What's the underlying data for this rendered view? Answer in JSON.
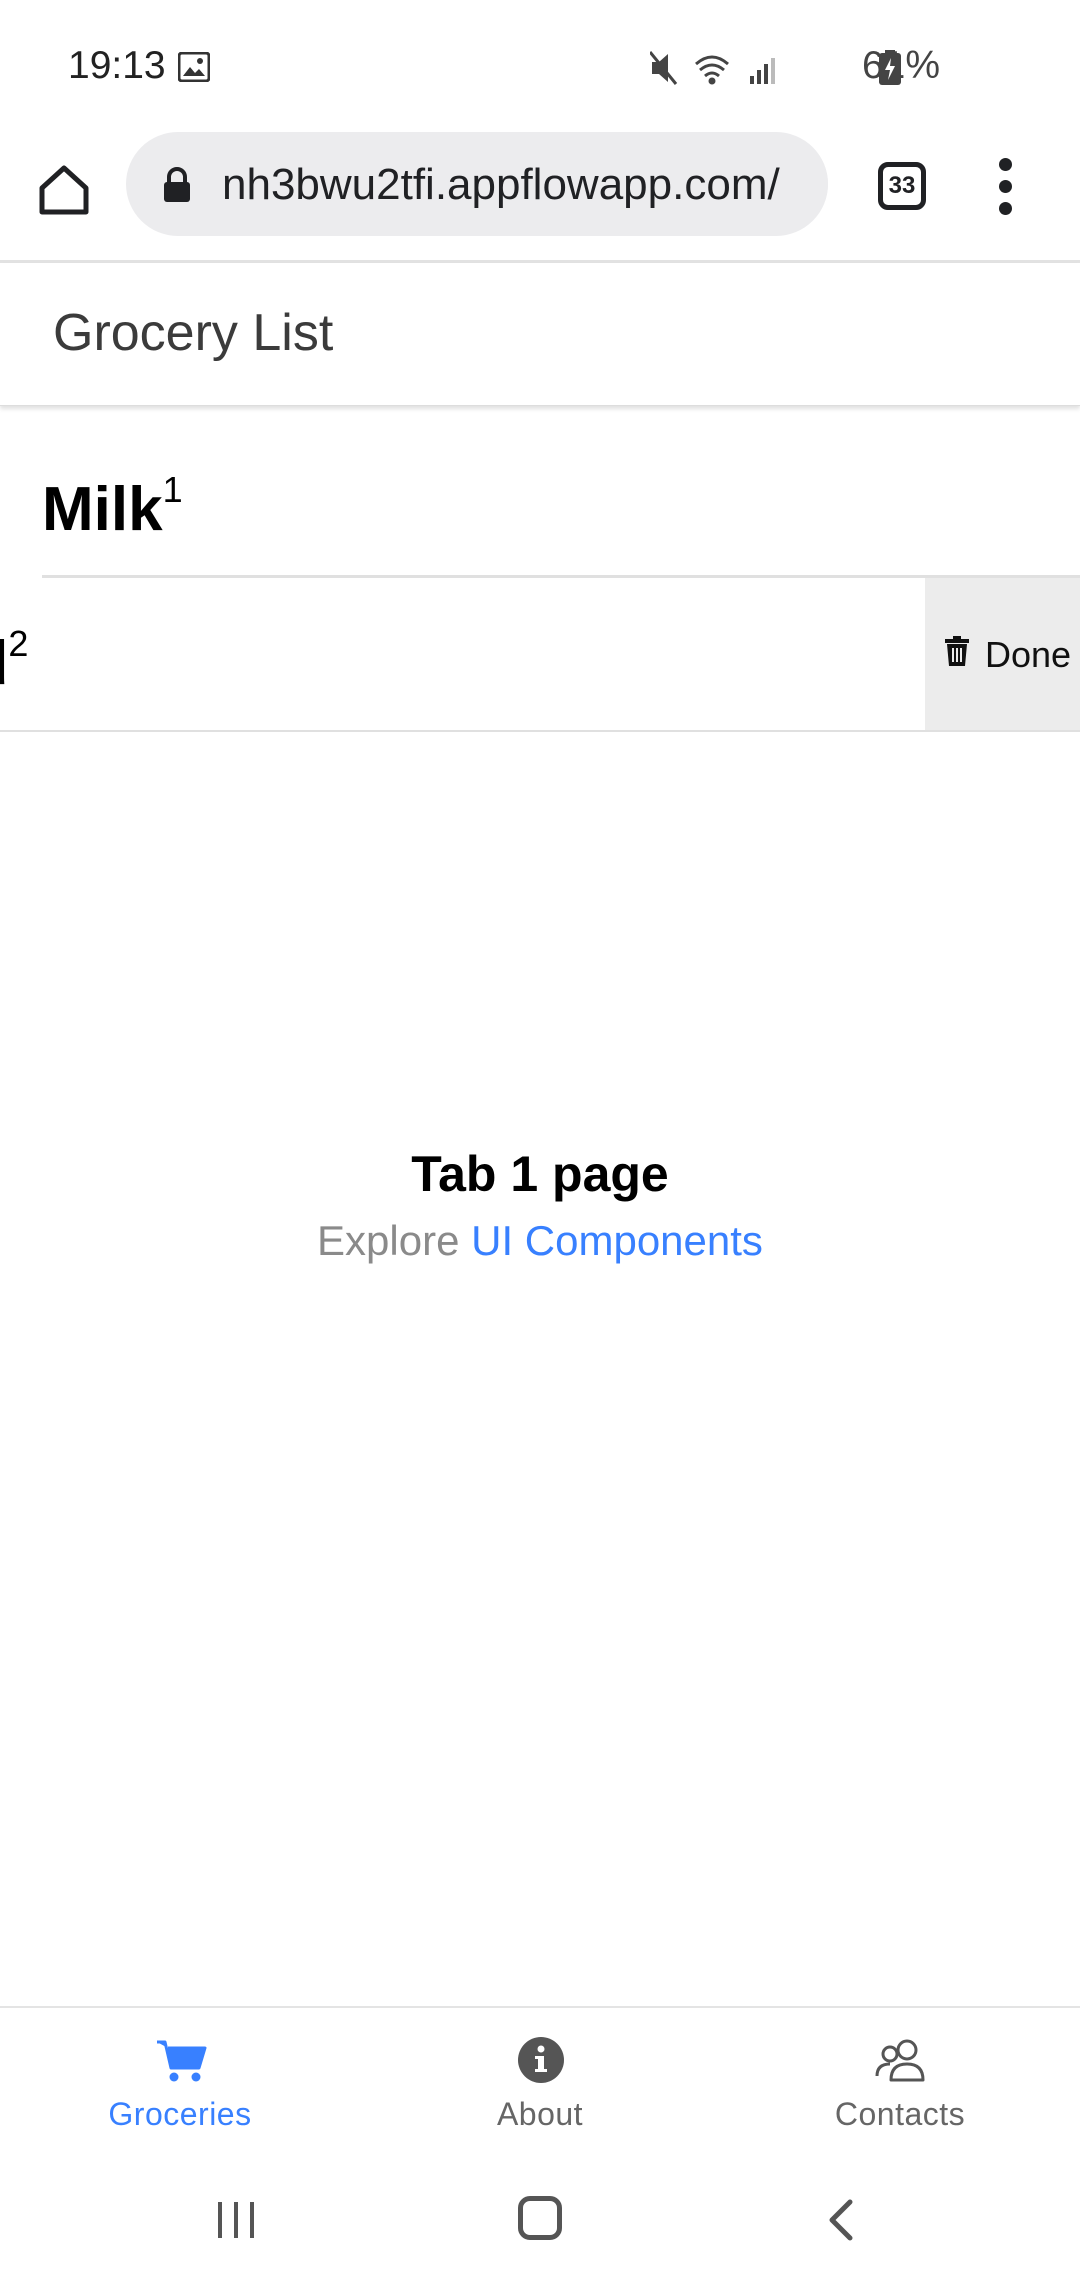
{
  "status_bar": {
    "time": "19:13",
    "battery": "61%",
    "icons": [
      "gallery-icon",
      "mute-icon",
      "wifi-icon",
      "signal-icon",
      "battery-charging-icon"
    ]
  },
  "browser": {
    "url": "nh3bwu2tfi.appflowapp.com/",
    "tab_count": "33",
    "icons": [
      "home-icon",
      "lock-icon",
      "more-vert-icon"
    ]
  },
  "header": {
    "title": "Grocery List"
  },
  "list": {
    "items": [
      {
        "name": "Milk",
        "quantity": "1"
      },
      {
        "name": "ad",
        "quantity": "2",
        "swipe_option": "Done"
      }
    ]
  },
  "main": {
    "title": "Tab 1 page",
    "subtitle_prefix": "Explore",
    "subtitle_link": "UI Components"
  },
  "tabs": [
    {
      "label": "Groceries",
      "icon": "cart-icon",
      "active": true
    },
    {
      "label": "About",
      "icon": "info-icon",
      "active": false
    },
    {
      "label": "Contacts",
      "icon": "people-icon",
      "active": false
    }
  ],
  "colors": {
    "accent": "#3880ff",
    "muted_text": "#8a8a8a",
    "swipe_option_bg": "#ececec"
  }
}
